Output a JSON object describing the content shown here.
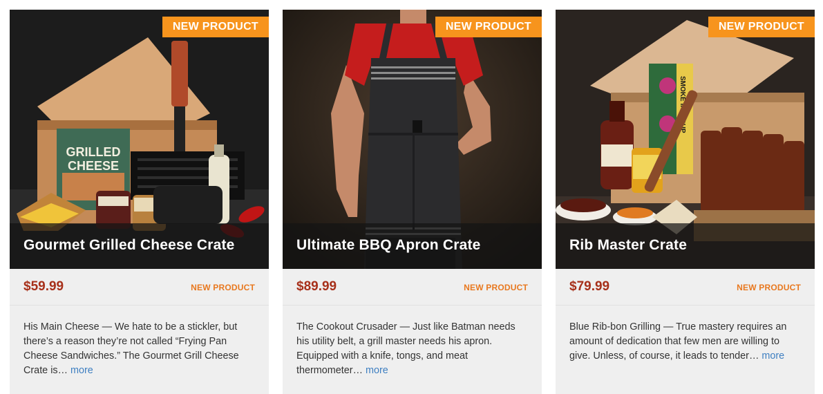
{
  "cards": [
    {
      "badge": "NEW PRODUCT",
      "title": "Gourmet Grilled Cheese Crate",
      "price": "$59.99",
      "tag": "NEW PRODUCT",
      "description": "His Main Cheese — We hate to be a stickler, but there’s a reason they’re not called “Frying Pan Cheese Sandwiches.” The Gourmet Grill Cheese Crate is…",
      "more": "more",
      "book_title_1": "GRILLED",
      "book_title_2": "CHEESE"
    },
    {
      "badge": "NEW PRODUCT",
      "title": "Ultimate BBQ Apron Crate",
      "price": "$89.99",
      "tag": "NEW PRODUCT",
      "description": "The Cookout Crusader — Just like Batman needs his utility belt, a grill master needs his apron. Equipped with a knife, tongs, and meat thermometer…",
      "more": "more"
    },
    {
      "badge": "NEW PRODUCT",
      "title": "Rib Master Crate",
      "price": "$79.99",
      "tag": "NEW PRODUCT",
      "description": "Blue Rib-bon Grilling — True mastery requires an amount of dedication that few men are willing to give. Unless, of course, it leads to tender…",
      "more": "more",
      "box_text": "SMOKE IN A CUP"
    }
  ],
  "colors": {
    "badge": "#f7941d",
    "price": "#a7301a",
    "tag": "#e8781f",
    "link": "#3e7fc1",
    "card_bg": "#efefef"
  }
}
